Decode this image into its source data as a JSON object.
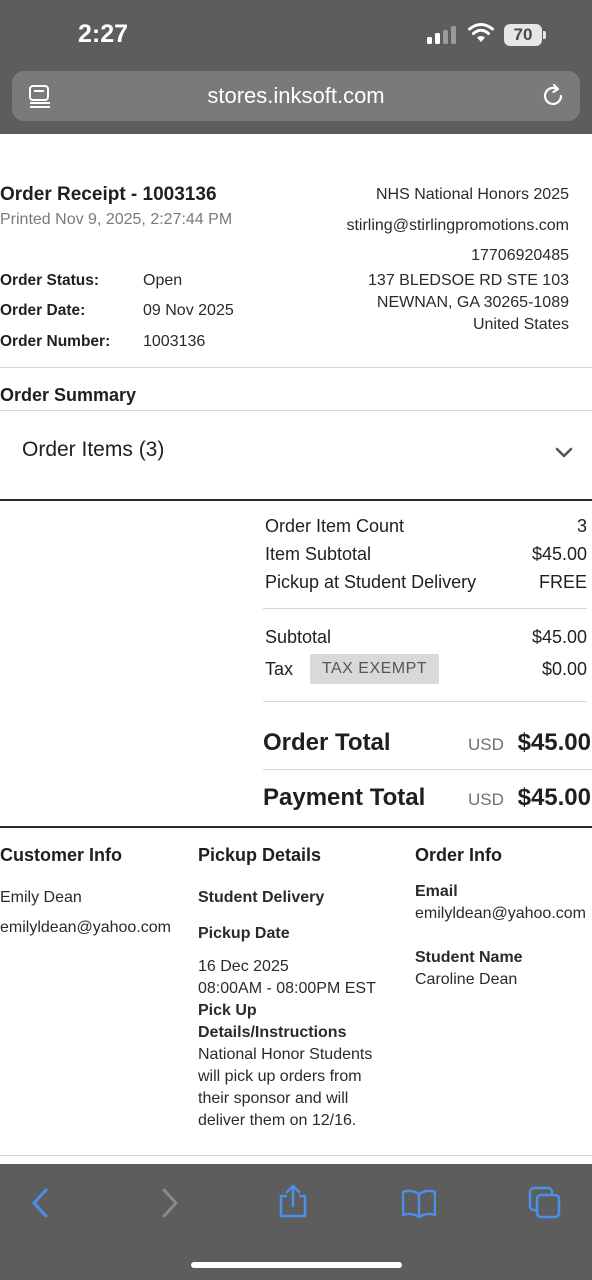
{
  "status_bar": {
    "time": "2:27",
    "battery": "70"
  },
  "browser": {
    "url": "stores.inksoft.com",
    "accent_color": "#4b8fe6"
  },
  "receipt": {
    "title": "Order Receipt - 1003136",
    "printed": "Printed Nov 9, 2025, 2:27:44 PM",
    "store": {
      "name": "NHS National Honors 2025",
      "email": "stirling@stirlingpromotions.com",
      "phone": "17706920485",
      "address1": "137 BLEDSOE RD STE 103",
      "address2": "NEWNAN, GA 30265-1089",
      "country": "United States"
    },
    "status_label": "Order Status:",
    "status_value": "Open",
    "date_label": "Order Date:",
    "date_value": "09 Nov 2025",
    "number_label": "Order Number:",
    "number_value": "1003136"
  },
  "summary": {
    "heading": "Order Summary",
    "items_toggle": "Order Items (3)",
    "rows": [
      {
        "label": "Order Item Count",
        "value": "3"
      },
      {
        "label": "Item Subtotal",
        "value": "$45.00"
      },
      {
        "label": "Pickup at Student Delivery",
        "value": "FREE"
      }
    ],
    "subtotal_label": "Subtotal",
    "subtotal_value": "$45.00",
    "tax_label": "Tax",
    "tax_badge": "TAX EXEMPT",
    "tax_value": "$0.00",
    "order_total_label": "Order Total",
    "order_total_currency": "USD",
    "order_total_value": "$45.00",
    "payment_total_label": "Payment Total",
    "payment_total_currency": "USD",
    "payment_total_value": "$45.00"
  },
  "customer": {
    "heading": "Customer Info",
    "name": "Emily Dean",
    "email": "emilyldean@yahoo.com"
  },
  "pickup": {
    "heading": "Pickup Details",
    "method": "Student Delivery",
    "date_label": "Pickup Date",
    "date": "16 Dec 2025",
    "time": "08:00AM - 08:00PM EST",
    "instructions_label_1": "Pick Up",
    "instructions_label_2": "Details/Instructions",
    "instructions": [
      "National Honor Students",
      "will pick up orders from",
      "their sponsor and will",
      "deliver them on 12/16."
    ]
  },
  "order_info": {
    "heading": "Order Info",
    "email_label": "Email",
    "email": "emilyldean@yahoo.com",
    "student_label": "Student Name",
    "student": "Caroline Dean"
  },
  "toolbar": {
    "icons": [
      "back-icon",
      "forward-icon",
      "share-icon",
      "bookmarks-icon",
      "tabs-icon"
    ]
  }
}
